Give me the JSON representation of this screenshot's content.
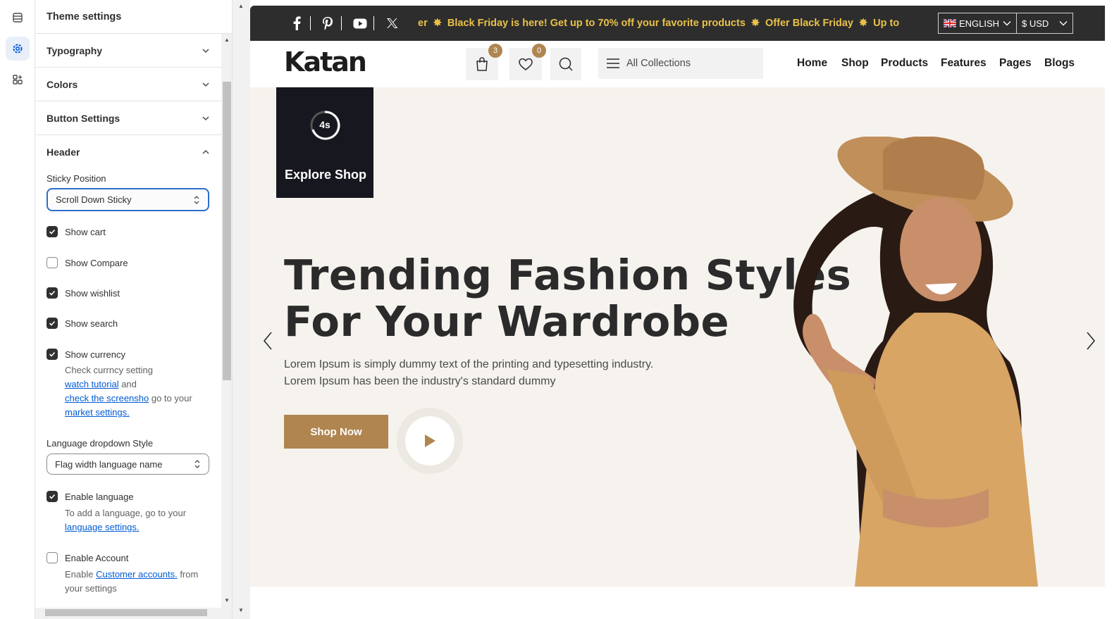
{
  "panel": {
    "title": "Theme settings",
    "sections": [
      "Typography",
      "Colors",
      "Button Settings",
      "Header"
    ],
    "sticky_label": "Sticky Position",
    "sticky_value": "Scroll Down Sticky",
    "checks": [
      {
        "label": "Show cart",
        "checked": true
      },
      {
        "label": "Show Compare",
        "checked": false
      },
      {
        "label": "Show wishlist",
        "checked": true
      },
      {
        "label": "Show search",
        "checked": true
      },
      {
        "label": "Show currency",
        "checked": true
      }
    ],
    "currency_help": {
      "line1": "Check currncy setting",
      "link1": "watch tutorial",
      "and": " and",
      "link2": "check the screensho",
      "goto": " go to your",
      "link3": "market settings."
    },
    "lang_style_label": "Language dropdown Style",
    "lang_style_value": "Flag width language name",
    "enable_language": {
      "label": "Enable language",
      "checked": true
    },
    "language_help": {
      "text": "To add a language, go to your",
      "link": "language settings."
    },
    "enable_account": {
      "label": "Enable Account",
      "checked": false
    },
    "account_help": {
      "pre": "Enable ",
      "link": "Customer accounts.",
      "post": " from your settings"
    }
  },
  "store": {
    "ticker": [
      "er",
      "Black Friday is here! Get up to 70% off your favorite products",
      "Offer Black Friday",
      "Up to"
    ],
    "language": "ENGLISH",
    "currency": "$ USD",
    "logo": "Katan",
    "cart_count": "3",
    "wishlist_count": "0",
    "collections": "All Collections",
    "nav": [
      "Home",
      "Shop",
      "Products",
      "Features",
      "Pages",
      "Blogs"
    ],
    "timer": "4s",
    "explore": "Explore Shop",
    "headline_1": "Trending Fashion Styles",
    "headline_2": "For Your Wardrobe",
    "description": "Lorem Ipsum is simply dummy text of the printing and typesetting industry. Lorem Ipsum has been the industry's standard dummy",
    "cta": "Shop Now"
  },
  "colors": {
    "accent": "#b08550",
    "topbar": "#2d2d2d",
    "ticker": "#e9c148",
    "hero_bg": "#f6f3ee"
  },
  "icons": [
    "sections-icon",
    "theme-settings-icon",
    "apps-icon",
    "facebook-icon",
    "pinterest-icon",
    "youtube-icon",
    "x-icon",
    "cart-icon",
    "wishlist-icon",
    "search-icon",
    "menu-icon",
    "play-icon"
  ]
}
